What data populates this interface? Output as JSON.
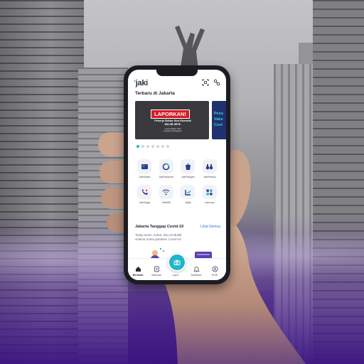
{
  "app": {
    "logo_text": "jaki",
    "accent_color": "#1fb6c9",
    "top_icons": [
      "scan-qr-icon",
      "notification-icon"
    ]
  },
  "header": {
    "section_title": "Terbaru di Jakarta"
  },
  "carousel": {
    "active_index": 0,
    "dot_count": 7,
    "slides": [
      {
        "headline": "LAPORKAN!",
        "line1": "Pekerja Sektor Non-Esensial",
        "line2": "WAJIB WFH!",
        "line3": "Lewat Aplikasi JAKI",
        "line4": "Laporkan pelanggaran"
      },
      {
        "line1": "Peny",
        "line2": "Vaks",
        "line3": "Covi"
      }
    ]
  },
  "services": [
    {
      "label": "JakWarta",
      "icon": "news-icon"
    },
    {
      "label": "JakRespons",
      "icon": "respons-icon"
    },
    {
      "label": "JakPangan",
      "icon": "food-icon"
    },
    {
      "label": "JakPantau",
      "icon": "binoculars-icon"
    },
    {
      "label": "JakSiaga",
      "icon": "phone-emergency-icon"
    },
    {
      "label": "JakWifi",
      "icon": "wifi-icon"
    },
    {
      "label": "Jejak",
      "icon": "trace-icon"
    },
    {
      "label": "Lainnya",
      "icon": "more-grid-icon"
    }
  ],
  "covid": {
    "title": "Jakarta Tanggap Covid-19",
    "link_label": "Lihat Semua",
    "desc_line1": "Tetap aman, sehat, dan produktif",
    "desc_line2": "selama masa pandemi Covid-19"
  },
  "tabbar": {
    "items": [
      {
        "label": "Beranda",
        "icon": "home-icon",
        "active": true
      },
      {
        "label": "Aktivitas",
        "icon": "activity-icon",
        "active": false
      },
      {
        "label": "Lapor",
        "icon": "camera-icon",
        "active": false
      },
      {
        "label": "Notifikasi",
        "icon": "bell-icon",
        "active": false
      },
      {
        "label": "Profil",
        "icon": "profile-icon",
        "active": false
      }
    ]
  }
}
